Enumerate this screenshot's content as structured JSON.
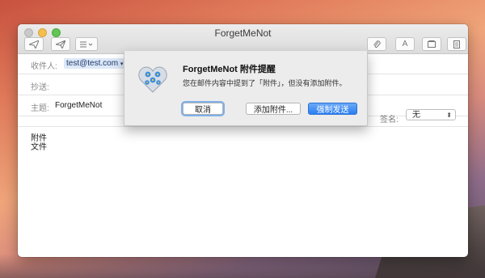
{
  "window": {
    "title": "ForgetMeNot"
  },
  "toolbar": {
    "send_icon": "paper-plane-icon",
    "reply_icon": "paper-plane-outline-icon",
    "format_icon": "list-icon",
    "attach_icon": "paperclip-icon",
    "font_label": "A",
    "photo_icon": "photo-browser-icon",
    "template_icon": "stationery-icon"
  },
  "header": {
    "to_label": "收件人:",
    "to_value": "test@test.com",
    "cc_label": "抄送:",
    "subject_label": "主题:",
    "subject_value": "ForgetMeNot",
    "signature_label": "签名:",
    "signature_value": "无"
  },
  "body": {
    "lines": [
      "附件",
      "文件"
    ]
  },
  "dialog": {
    "title": "ForgetMeNot 附件提醒",
    "message": "您在邮件内容中提到了「附件」，但没有添加附件。",
    "cancel_label": "取消",
    "add_label": "添加附件...",
    "send_label": "强制发送"
  }
}
